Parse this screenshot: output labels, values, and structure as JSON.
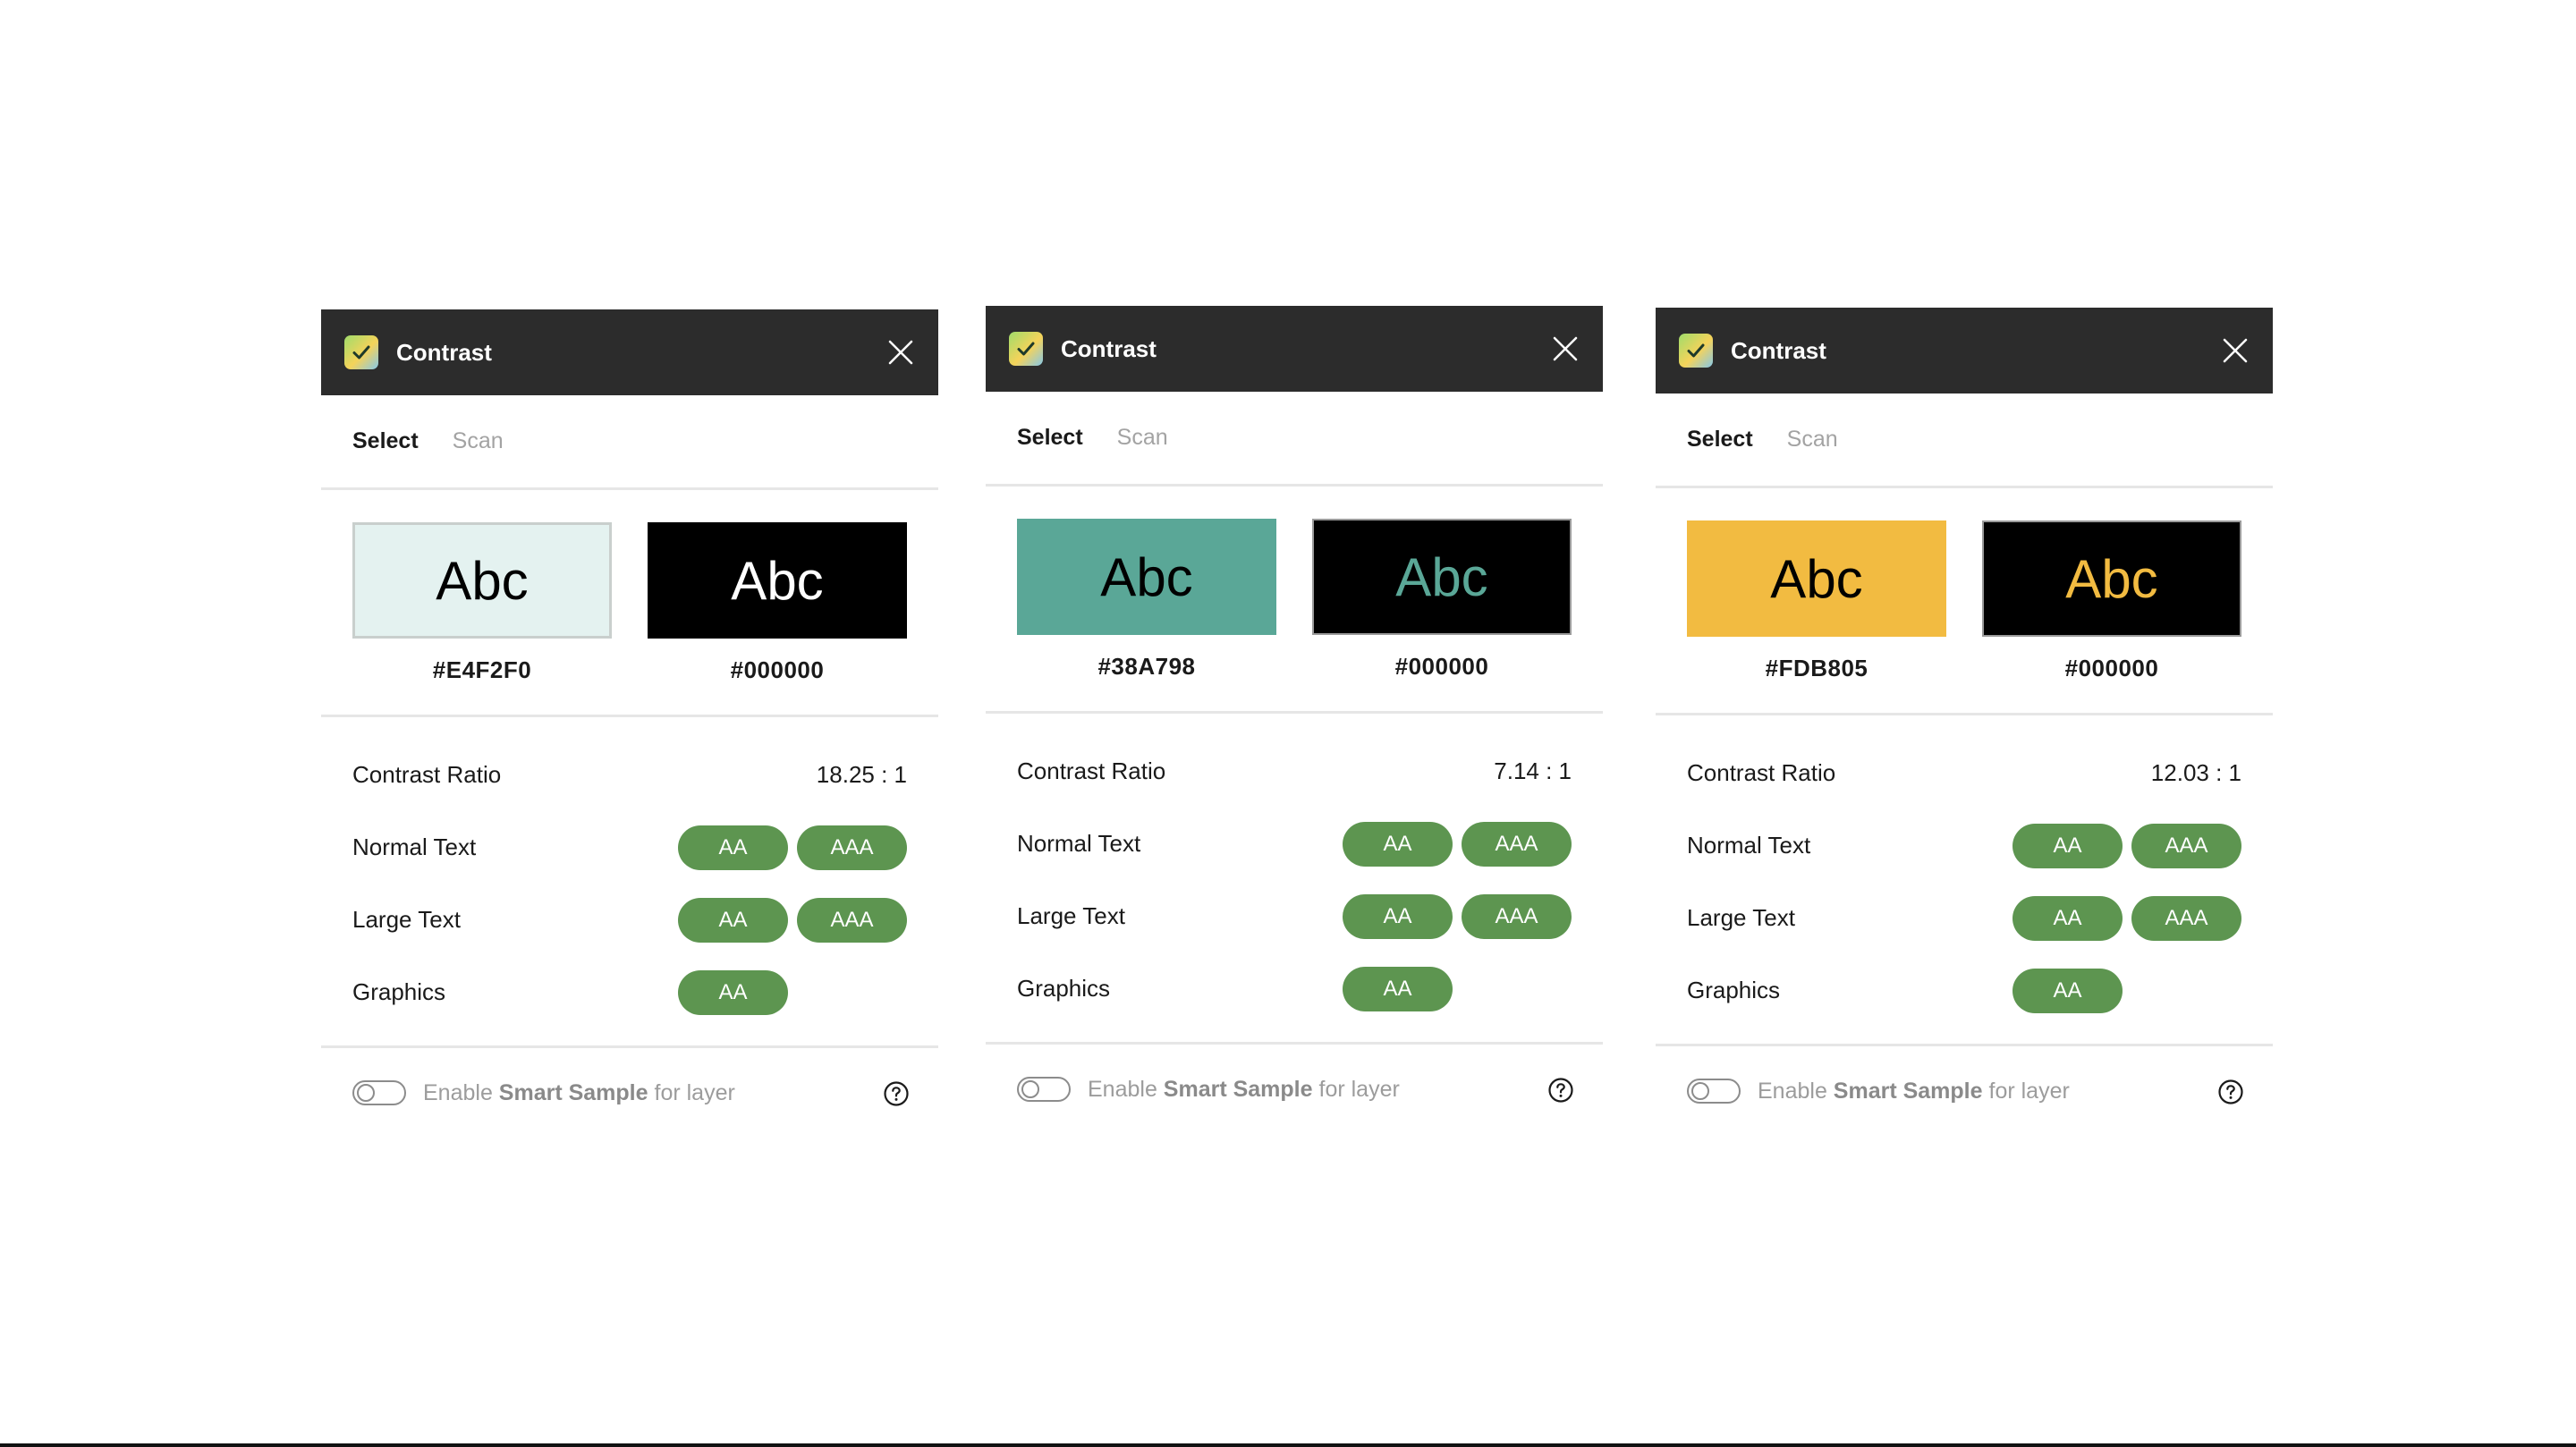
{
  "panels": [
    {
      "title": "Contrast",
      "tabs": [
        "Select",
        "Scan"
      ],
      "swatch_text": "Abc",
      "background": {
        "hex": "#E4F2F0",
        "color": "#E4F2F0"
      },
      "foreground": {
        "hex": "#000000",
        "color": "#000000"
      },
      "preview_text_color": "#E4F2F0",
      "contrast_label": "Contrast Ratio",
      "contrast_value": "18.25 : 1",
      "rows": [
        {
          "label": "Normal Text",
          "badges": [
            "AA",
            "AAA"
          ]
        },
        {
          "label": "Large Text",
          "badges": [
            "AA",
            "AAA"
          ]
        },
        {
          "label": "Graphics",
          "badges": [
            "AA"
          ]
        }
      ],
      "footer": {
        "prefix": "Enable ",
        "bold": "Smart Sample",
        "suffix": " for layer"
      }
    },
    {
      "title": "Contrast",
      "tabs": [
        "Select",
        "Scan"
      ],
      "swatch_text": "Abc",
      "background": {
        "hex": "#38A798",
        "color": "#5aa797"
      },
      "foreground": {
        "hex": "#000000",
        "color": "#000000"
      },
      "preview_text_color": "#5aa797",
      "contrast_label": "Contrast Ratio",
      "contrast_value": "7.14 : 1",
      "rows": [
        {
          "label": "Normal Text",
          "badges": [
            "AA",
            "AAA"
          ]
        },
        {
          "label": "Large Text",
          "badges": [
            "AA",
            "AAA"
          ]
        },
        {
          "label": "Graphics",
          "badges": [
            "AA"
          ]
        }
      ],
      "footer": {
        "prefix": "Enable ",
        "bold": "Smart Sample",
        "suffix": " for layer"
      }
    },
    {
      "title": "Contrast",
      "tabs": [
        "Select",
        "Scan"
      ],
      "swatch_text": "Abc",
      "background": {
        "hex": "#FDB805",
        "color": "#f2bb41"
      },
      "foreground": {
        "hex": "#000000",
        "color": "#000000"
      },
      "preview_text_color": "#f2bb41",
      "contrast_label": "Contrast Ratio",
      "contrast_value": "12.03 : 1",
      "rows": [
        {
          "label": "Normal Text",
          "badges": [
            "AA",
            "AAA"
          ]
        },
        {
          "label": "Large Text",
          "badges": [
            "AA",
            "AAA"
          ]
        },
        {
          "label": "Graphics",
          "badges": [
            "AA"
          ]
        }
      ],
      "footer": {
        "prefix": "Enable ",
        "bold": "Smart Sample",
        "suffix": " for layer"
      }
    }
  ],
  "colors": {
    "titlebar": "#2c2c2c",
    "badge_pass": "#5d9550",
    "divider": "#e6e6e6"
  },
  "icons": {
    "app": "checkmark-logo-icon",
    "close": "close-icon",
    "help": "question-circle-icon",
    "toggle": "toggle-switch-off"
  }
}
